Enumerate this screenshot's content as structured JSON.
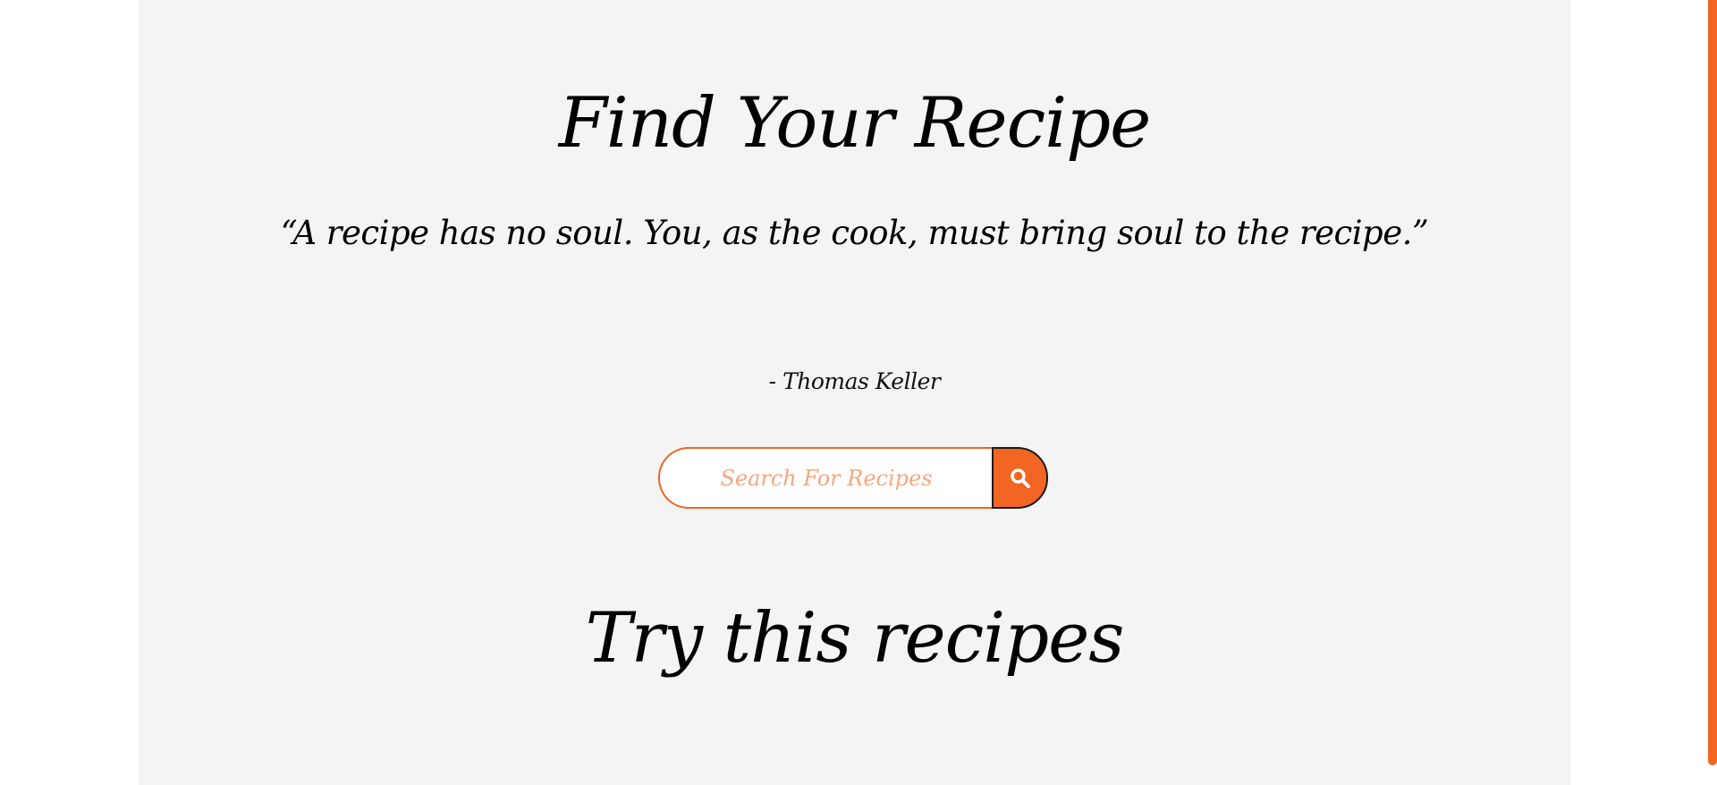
{
  "hero": {
    "title": "Find Your Recipe",
    "quote": "“A recipe has no soul. You, as the cook, must bring soul to the recipe.”",
    "author": "- Thomas Keller"
  },
  "search": {
    "placeholder": "Search For Recipes",
    "value": "",
    "button_icon": "search-icon"
  },
  "recipes_section": {
    "title": "Try this recipes"
  },
  "colors": {
    "accent": "#f26522",
    "panel_background": "#f4f4f4",
    "page_background": "#ffffff",
    "placeholder_text": "#f4a77d"
  }
}
